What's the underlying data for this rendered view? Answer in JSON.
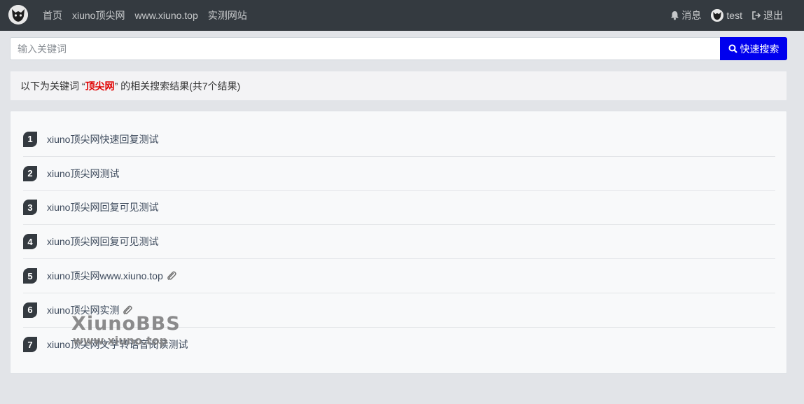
{
  "nav": {
    "logo_icon": "xiuno-mascot-icon",
    "links": [
      "首页",
      "xiuno顶尖网",
      "www.xiuno.top",
      "实测网站"
    ],
    "messages_label": "消息",
    "user_name": "test",
    "logout_label": "退出"
  },
  "search": {
    "placeholder": "输入关键词",
    "value": "",
    "button_label": "快速搜索",
    "button_color": "#0000ee"
  },
  "info": {
    "prefix": "以下为关键词 “",
    "keyword": "顶尖网",
    "suffix": "” 的相关搜索结果(共7个结果)",
    "keyword_color": "#e00000"
  },
  "results": [
    {
      "num": "1",
      "title": "xiuno顶尖网快速回复测试",
      "attachment": false
    },
    {
      "num": "2",
      "title": "xiuno顶尖网测试",
      "attachment": false
    },
    {
      "num": "3",
      "title": "xiuno顶尖网回复可见测试",
      "attachment": false
    },
    {
      "num": "4",
      "title": "xiuno顶尖网回复可见测试",
      "attachment": false
    },
    {
      "num": "5",
      "title": "xiuno顶尖网www.xiuno.top",
      "attachment": true
    },
    {
      "num": "6",
      "title": "xiuno顶尖网实测",
      "attachment": true
    },
    {
      "num": "7",
      "title": "xiuno顶尖网文字转语音阅读测试",
      "attachment": false
    }
  ],
  "watermark": {
    "line1": "XiunoBBS",
    "line2": "www.xiuno.top"
  }
}
